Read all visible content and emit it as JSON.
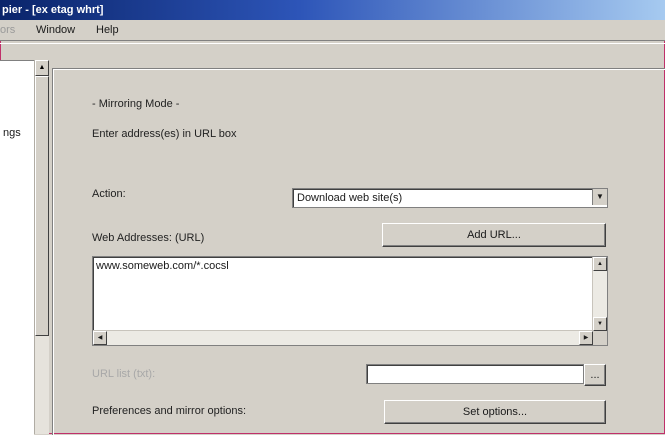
{
  "window": {
    "title": "pier - [ex etag whrt]"
  },
  "menubar": {
    "partial_item": "ors",
    "items": [
      "Window",
      "Help"
    ]
  },
  "tree": {
    "partial_label": "ngs"
  },
  "panel": {
    "mode_title": "- Mirroring Mode -",
    "mode_description": "Enter address(es) in URL box",
    "action_label": "Action:",
    "action_value": "Download web site(s)",
    "web_addresses_label": "Web Addresses: (URL)",
    "add_url_button": "Add URL...",
    "url_text": "www.someweb.com/*.cocsl",
    "url_list_label": "URL list (txt):",
    "url_list_value": "",
    "browse_button": "...",
    "preferences_label": "Preferences and mirror options:",
    "set_options_button": "Set options..."
  },
  "icons": {
    "dropdown": "chevron-down-icon",
    "scroll_up": "scroll-up-arrow-icon",
    "scroll_down": "scroll-down-arrow-icon",
    "scroll_left": "scroll-left-arrow-icon",
    "scroll_right": "scroll-right-arrow-icon"
  },
  "colors": {
    "titlebar_start": "#0a246a",
    "titlebar_end": "#a6caf0",
    "window_face": "#d4d0c8",
    "frame_border": "#c0306a"
  }
}
